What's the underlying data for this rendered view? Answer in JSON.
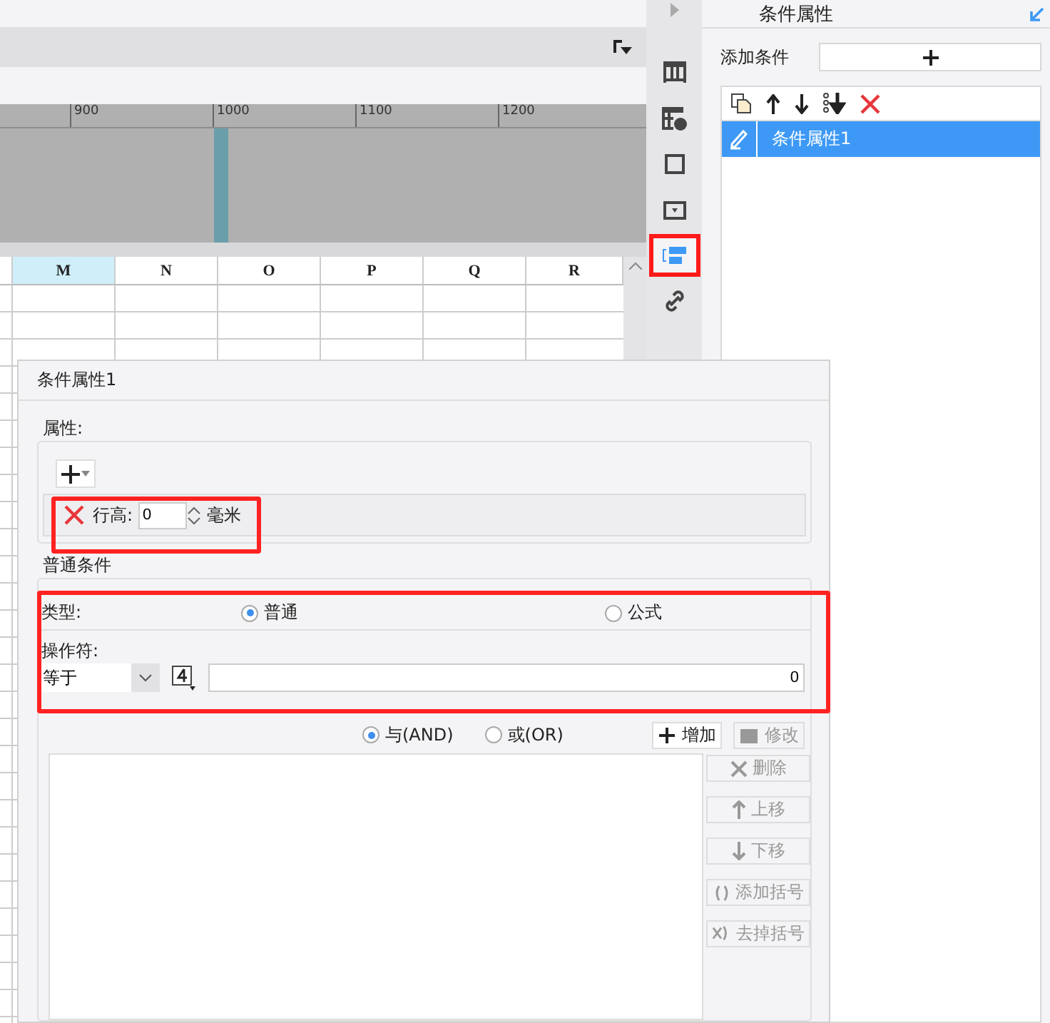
{
  "ruler": {
    "ticks": [
      "900",
      "1000",
      "1100",
      "1200"
    ]
  },
  "sheet": {
    "columns": [
      {
        "label": "M",
        "selected": true
      },
      {
        "label": "N",
        "selected": false
      },
      {
        "label": "O",
        "selected": false
      },
      {
        "label": "P",
        "selected": false
      },
      {
        "label": "Q",
        "selected": false
      },
      {
        "label": "R",
        "selected": false
      }
    ]
  },
  "side_icons": [
    {
      "kind": "grid",
      "selected": false
    },
    {
      "kind": "table-info",
      "selected": false
    },
    {
      "kind": "frame",
      "selected": false
    },
    {
      "kind": "dropdown",
      "selected": false
    },
    {
      "kind": "condition",
      "selected": true
    },
    {
      "kind": "link",
      "selected": false
    }
  ],
  "panel": {
    "title": "条件属性",
    "add_label": "添加条件",
    "conditions": [
      {
        "name": "条件属性1",
        "selected": true
      }
    ]
  },
  "dialog": {
    "title": "条件属性1",
    "attributes_label": "属性:",
    "property_rows": [
      {
        "label": "行高:",
        "value": "0",
        "unit": "毫米"
      }
    ],
    "common_label": "普通条件",
    "type_label": "类型:",
    "type_options": [
      {
        "label": "普通",
        "selected": true
      },
      {
        "label": "公式",
        "selected": false
      }
    ],
    "operator_label": "操作符:",
    "operator": "等于",
    "value": "0",
    "logic_options": [
      {
        "label": "与(AND)",
        "selected": true
      },
      {
        "label": "或(OR)",
        "selected": false
      }
    ],
    "actions": [
      {
        "label": "增加",
        "kind": "plus",
        "disabled": false
      },
      {
        "label": "修改",
        "kind": "edit",
        "disabled": true
      }
    ],
    "side_actions": [
      {
        "label": "删除",
        "kind": "delete",
        "disabled": true
      },
      {
        "label": "上移",
        "kind": "up",
        "disabled": true
      },
      {
        "label": "下移",
        "kind": "down",
        "disabled": true
      },
      {
        "label": "添加括号",
        "kind": "add-paren",
        "disabled": true
      },
      {
        "label": "去掉括号",
        "kind": "remove-paren",
        "disabled": true
      }
    ]
  }
}
